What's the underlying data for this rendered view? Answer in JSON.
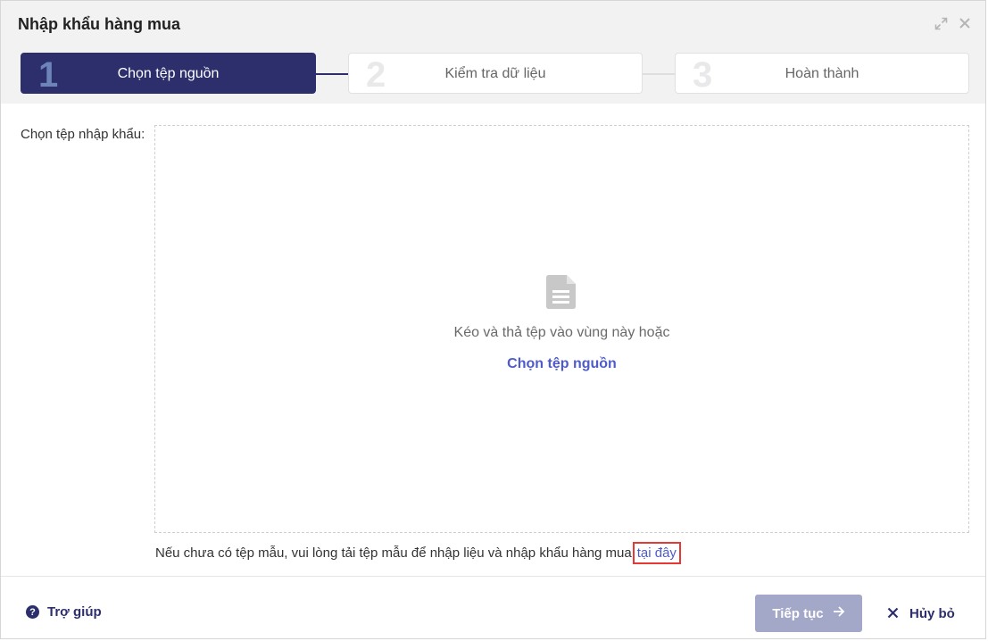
{
  "dialog": {
    "title": "Nhập khẩu hàng mua"
  },
  "steps": [
    {
      "number": "1",
      "label": "Chọn tệp nguồn",
      "active": true
    },
    {
      "number": "2",
      "label": "Kiểm tra dữ liệu",
      "active": false
    },
    {
      "number": "3",
      "label": "Hoàn thành",
      "active": false
    }
  ],
  "form": {
    "file_label": "Chọn tệp nhập khẩu:",
    "drop_text": "Kéo và thả tệp vào vùng này hoặc",
    "choose_link": "Chọn tệp nguồn",
    "hint_text": "Nếu chưa có tệp mẫu, vui lòng tải tệp mẫu để nhập liệu và nhập khẩu hàng mua",
    "hint_link": "tại đây"
  },
  "footer": {
    "help_label": "Trợ giúp",
    "next_label": "Tiếp tục",
    "cancel_label": "Hủy bỏ"
  },
  "colors": {
    "accent": "#2c2f6c",
    "link": "#4e5bc9",
    "highlight_box": "#e53935",
    "next_button_disabled": "#a3a8c9"
  },
  "icons": {
    "expand": "expand-icon",
    "close": "close-icon",
    "file": "file-document-icon",
    "help": "question-circle-icon",
    "next": "arrow-right-icon",
    "cancel": "x-icon"
  }
}
